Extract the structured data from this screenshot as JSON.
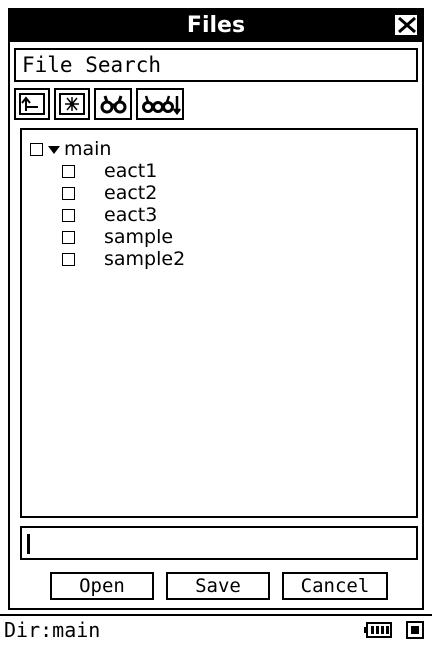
{
  "window": {
    "title": "Files"
  },
  "menubar": {
    "items": [
      {
        "label": "File Search"
      }
    ]
  },
  "toolbar": {
    "buttons": [
      {
        "icon": "folder-up-icon"
      },
      {
        "icon": "new-folder-icon"
      },
      {
        "icon": "search-icon"
      },
      {
        "icon": "search-next-icon"
      }
    ]
  },
  "tree": {
    "root": {
      "label": "main",
      "expanded": true,
      "checked": false
    },
    "items": [
      {
        "label": "eact1",
        "checked": false
      },
      {
        "label": "eact2",
        "checked": false
      },
      {
        "label": "eact3",
        "checked": false
      },
      {
        "label": "sample",
        "checked": false
      },
      {
        "label": "sample2",
        "checked": false
      }
    ]
  },
  "input": {
    "value": ""
  },
  "buttons": {
    "open": "Open",
    "save": "Save",
    "cancel": "Cancel"
  },
  "status": {
    "dir": "Dir:main"
  }
}
